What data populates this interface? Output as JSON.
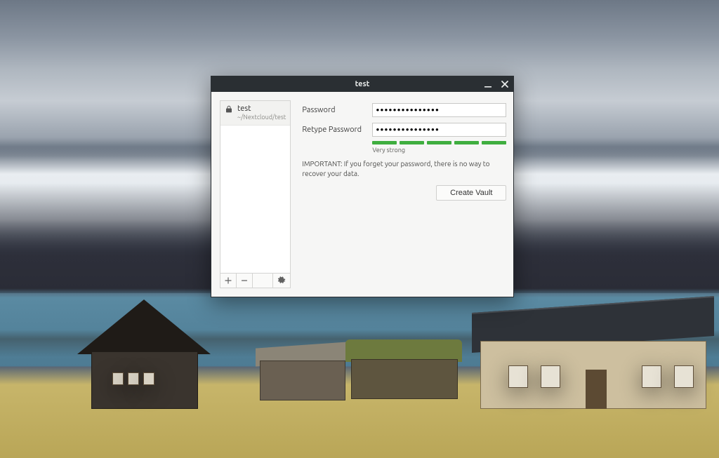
{
  "window": {
    "title": "test"
  },
  "sidebar": {
    "items": [
      {
        "name": "test",
        "path": "~/Nextcloud/test"
      }
    ]
  },
  "form": {
    "password_label": "Password",
    "retype_label": "Retype Password",
    "password_value": "•••••••••••••••",
    "retype_value": "•••••••••••••••",
    "strength_label": "Very strong",
    "strength_segments": 5,
    "important_text": "IMPORTANT: If you forget your password, there is no way to recover your data.",
    "create_button": "Create Vault"
  },
  "icons": {
    "lock": "lock-icon",
    "add": "plus-icon",
    "remove": "minus-icon",
    "settings": "gear-icon",
    "minimize": "minimize-icon",
    "close": "close-icon"
  }
}
